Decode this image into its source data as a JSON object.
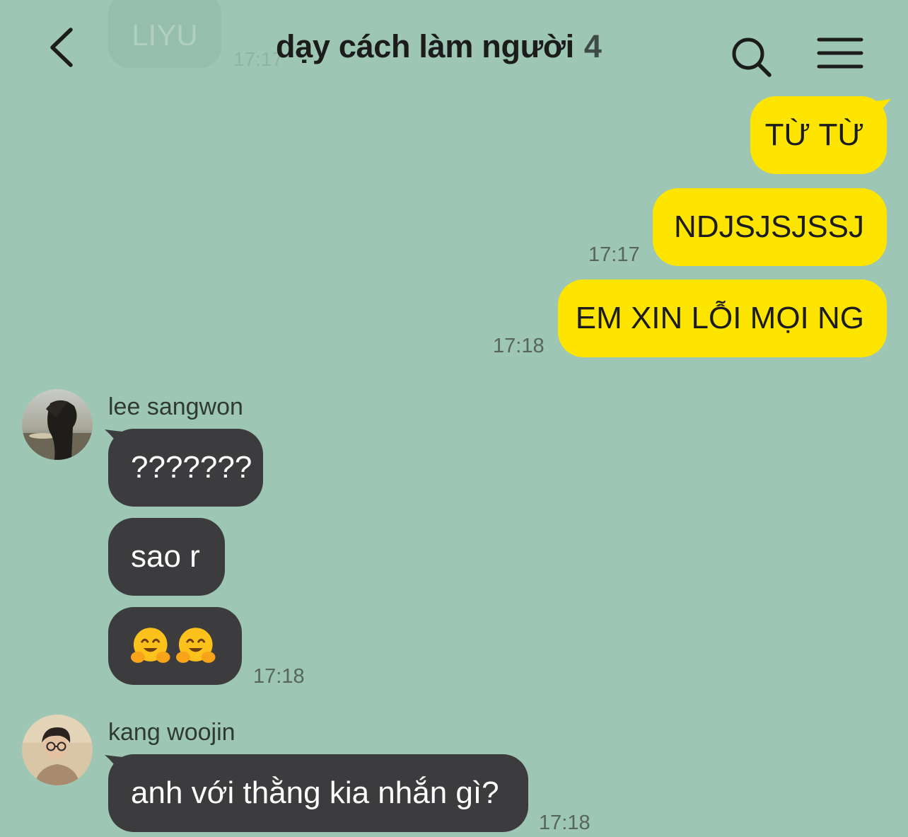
{
  "header": {
    "title": "dạy cách làm người",
    "member_count": "4"
  },
  "ghost_message": {
    "text": "LIYU",
    "time": "17:17"
  },
  "messages_mine": [
    {
      "text": "TỪ TỪ",
      "time": ""
    },
    {
      "text": "NDJSJSJSSJ",
      "time": "17:17"
    },
    {
      "text": "EM XIN LỖI MỌI NG",
      "time": "17:18"
    }
  ],
  "senders": [
    {
      "name": "lee sangwon",
      "messages": [
        {
          "text": "???????"
        },
        {
          "text": "sao r"
        },
        {
          "text": "",
          "emoji": "hugging-face",
          "count": 2,
          "time": "17:18"
        }
      ]
    },
    {
      "name": "kang woojin",
      "messages": [
        {
          "text": "anh với thằng kia nhắn gì?",
          "time": "17:18"
        }
      ]
    }
  ],
  "colors": {
    "background": "#9dc6b5",
    "my_bubble": "#fde500",
    "their_bubble": "#3c3c3e"
  }
}
